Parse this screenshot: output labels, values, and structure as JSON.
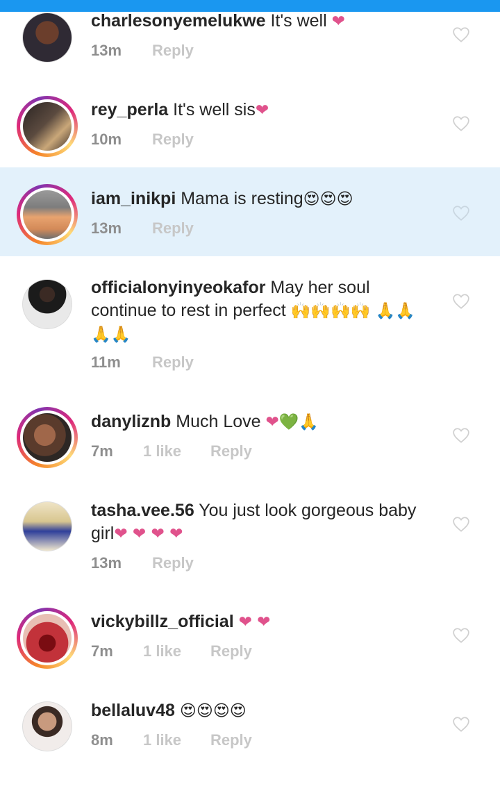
{
  "comments": [
    {
      "username": "charlesonyemelukwe",
      "text": "It's well",
      "emoji": "❤",
      "time": "13m",
      "likes": "",
      "reply_label": "Reply",
      "avatar_story": false,
      "highlighted": false
    },
    {
      "username": "rey_perla",
      "text": "It's well sis",
      "emoji": "❤",
      "time": "10m",
      "likes": "",
      "reply_label": "Reply",
      "avatar_story": true,
      "highlighted": false
    },
    {
      "username": "iam_inikpi",
      "text": "Mama is resting",
      "emoji": "😍😍😍",
      "time": "13m",
      "likes": "",
      "reply_label": "Reply",
      "avatar_story": true,
      "highlighted": true
    },
    {
      "username": "officialonyinyeokafor",
      "text": "May her soul continue to rest in perfect",
      "emoji": "🙌🙌🙌🙌 🙏🙏🙏🙏",
      "time": "11m",
      "likes": "",
      "reply_label": "Reply",
      "avatar_story": false,
      "highlighted": false
    },
    {
      "username": "danyliznb",
      "text": "Much Love",
      "emoji": "❤💚🙏",
      "time": "7m",
      "likes": "1 like",
      "reply_label": "Reply",
      "avatar_story": true,
      "highlighted": false
    },
    {
      "username": "tasha.vee.56",
      "text": "You just look gorgeous baby girl",
      "emoji": "❤ ❤ ❤ ❤",
      "time": "13m",
      "likes": "",
      "reply_label": "Reply",
      "avatar_story": false,
      "highlighted": false
    },
    {
      "username": "vickybillz_official",
      "text": "",
      "emoji": "❤ ❤",
      "time": "7m",
      "likes": "1 like",
      "reply_label": "Reply",
      "avatar_story": true,
      "highlighted": false
    },
    {
      "username": "bellaluv48",
      "text": "",
      "emoji": "😍😍😍😍",
      "time": "8m",
      "likes": "1 like",
      "reply_label": "Reply",
      "avatar_story": false,
      "highlighted": false
    }
  ],
  "colors": {
    "top_bar": "#1a97f0",
    "highlight": "#e3f1fb",
    "heart": "#e0528c",
    "meta_text": "#8e8e8e"
  },
  "icons": {
    "like": "heart-outline-icon"
  }
}
